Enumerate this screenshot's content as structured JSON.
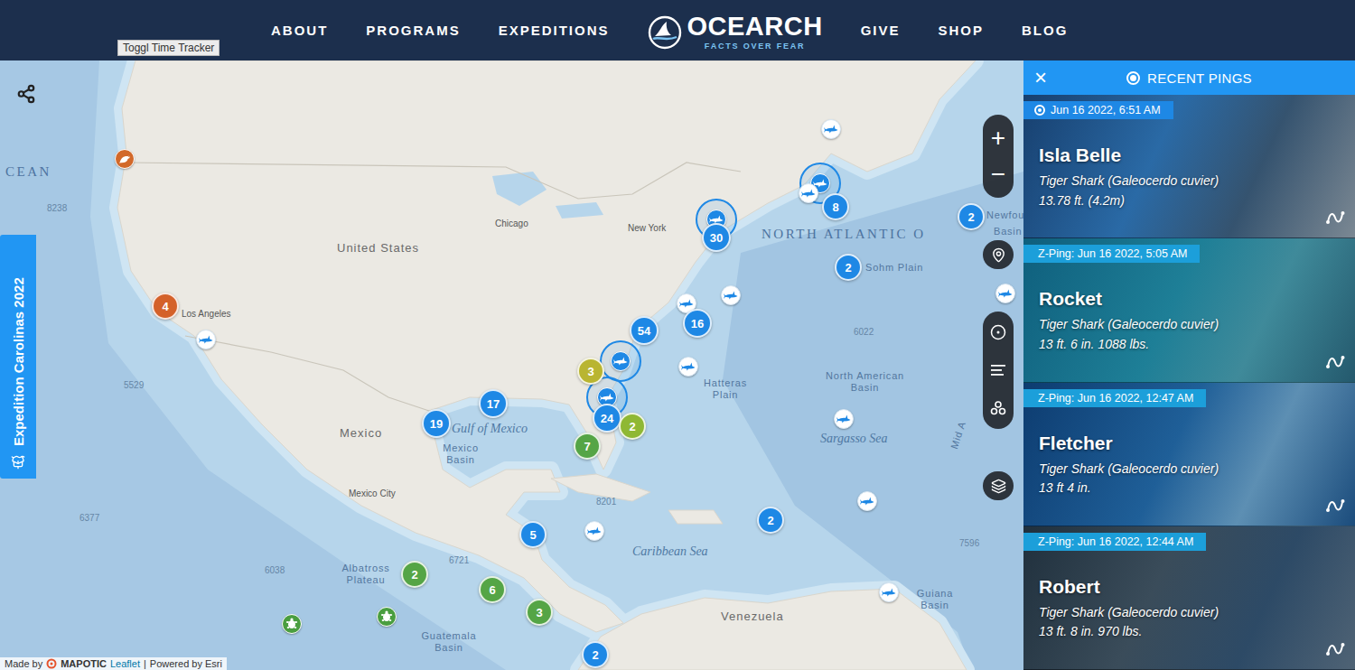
{
  "header": {
    "nav_left": [
      "ABOUT",
      "PROGRAMS",
      "EXPEDITIONS"
    ],
    "logo": {
      "name": "OCEARCH",
      "tagline": "FACTS OVER FEAR"
    },
    "nav_right": [
      "GIVE",
      "SHOP",
      "BLOG"
    ]
  },
  "tooltip": "Toggl Time Tracker",
  "map": {
    "expedition_tab": "Expedition Carolinas 2022",
    "controls": {
      "zoom_in": "+",
      "zoom_out": "−"
    },
    "attribution": {
      "made_by": "Made by",
      "brand": "MAPOTIC",
      "links": [
        "Leaflet",
        "Powered by Esri"
      ],
      "separator": "|"
    },
    "labels": [
      {
        "text": "CEAN",
        "kind": "ocean"
      },
      {
        "text": "8238",
        "kind": "depth"
      },
      {
        "text": "United States",
        "kind": "country"
      },
      {
        "text": "Chicago",
        "kind": "city"
      },
      {
        "text": "New York",
        "kind": "city"
      },
      {
        "text": "Los Angeles",
        "kind": "city"
      },
      {
        "text": "5529",
        "kind": "depth"
      },
      {
        "text": "Mexico",
        "kind": "country"
      },
      {
        "text": "Mexico City",
        "kind": "city"
      },
      {
        "text": "6377",
        "kind": "depth"
      },
      {
        "text": "Gulf of Mexico",
        "kind": "sea"
      },
      {
        "text": "Mexico Basin",
        "kind": "feature"
      },
      {
        "text": "8201",
        "kind": "depth"
      },
      {
        "text": "Caribbean Sea",
        "kind": "sea"
      },
      {
        "text": "7596",
        "kind": "depth"
      },
      {
        "text": "Guiana Basin",
        "kind": "feature"
      },
      {
        "text": "Venezuela",
        "kind": "country"
      },
      {
        "text": "Albatross Plateau",
        "kind": "feature"
      },
      {
        "text": "6721",
        "kind": "depth"
      },
      {
        "text": "6038",
        "kind": "depth"
      },
      {
        "text": "Guatemala Basin",
        "kind": "feature"
      },
      {
        "text": "NORTH ATLANTIC O",
        "kind": "ocean"
      },
      {
        "text": "Sohm Plain",
        "kind": "feature"
      },
      {
        "text": "6022",
        "kind": "depth"
      },
      {
        "text": "North American Basin",
        "kind": "feature"
      },
      {
        "text": "Hatteras Plain",
        "kind": "feature"
      },
      {
        "text": "Sargasso Sea",
        "kind": "sea"
      },
      {
        "text": "Mid A",
        "kind": "rotated"
      },
      {
        "text": "Newfou",
        "kind": "feature"
      },
      {
        "text": "Basin",
        "kind": "feature"
      }
    ],
    "markers": [
      {
        "kind": "seal",
        "color": "#d2692a",
        "recent": false
      },
      {
        "kind": "cluster",
        "count": "4",
        "color": "#d4612a",
        "recent": false
      },
      {
        "kind": "shark",
        "color": "#1e88e5",
        "recent": false
      },
      {
        "kind": "shark",
        "color": "#1e88e5",
        "recent": false
      },
      {
        "kind": "shark",
        "color": "#1e88e5",
        "recent": true
      },
      {
        "kind": "shark",
        "color": "#1e88e5",
        "recent": false
      },
      {
        "kind": "cluster",
        "count": "8",
        "color": "#1e88e5",
        "recent": false
      },
      {
        "kind": "shark",
        "color": "#1e88e5",
        "recent": true
      },
      {
        "kind": "cluster",
        "count": "30",
        "color": "#1e88e5",
        "recent": false
      },
      {
        "kind": "cluster",
        "count": "2",
        "color": "#1e88e5",
        "recent": false
      },
      {
        "kind": "cluster",
        "count": "2",
        "color": "#1e88e5",
        "recent": false
      },
      {
        "kind": "shark",
        "color": "#1e88e5",
        "recent": false
      },
      {
        "kind": "shark",
        "color": "#1e88e5",
        "recent": false
      },
      {
        "kind": "shark",
        "color": "#1e88e5",
        "recent": false
      },
      {
        "kind": "cluster",
        "count": "54",
        "color": "#1e88e5",
        "recent": false
      },
      {
        "kind": "cluster",
        "count": "16",
        "color": "#1e88e5",
        "recent": false
      },
      {
        "kind": "shark",
        "color": "#1e88e5",
        "recent": true
      },
      {
        "kind": "shark",
        "color": "#1e88e5",
        "recent": false
      },
      {
        "kind": "cluster",
        "count": "3",
        "color": "#b9b531",
        "recent": false
      },
      {
        "kind": "cluster",
        "count": "17",
        "color": "#1e88e5",
        "recent": false
      },
      {
        "kind": "cluster",
        "count": "19",
        "color": "#1e88e5",
        "recent": false
      },
      {
        "kind": "shark",
        "color": "#1e88e5",
        "recent": true
      },
      {
        "kind": "cluster",
        "count": "24",
        "color": "#1e88e5",
        "recent": false
      },
      {
        "kind": "cluster",
        "count": "7",
        "color": "#55a546",
        "recent": false
      },
      {
        "kind": "cluster",
        "count": "2",
        "color": "#8fb834",
        "recent": false
      },
      {
        "kind": "shark",
        "color": "#1e88e5",
        "recent": false
      },
      {
        "kind": "shark",
        "color": "#1e88e5",
        "recent": false
      },
      {
        "kind": "shark",
        "color": "#1e88e5",
        "recent": false
      },
      {
        "kind": "shark",
        "color": "#1e88e5",
        "recent": false
      },
      {
        "kind": "cluster",
        "count": "2",
        "color": "#1e88e5",
        "recent": false
      },
      {
        "kind": "cluster",
        "count": "5",
        "color": "#1e88e5",
        "recent": false
      },
      {
        "kind": "cluster",
        "count": "2",
        "color": "#55a546",
        "recent": false
      },
      {
        "kind": "cluster",
        "count": "6",
        "color": "#55a546",
        "recent": false
      },
      {
        "kind": "cluster",
        "count": "3",
        "color": "#55a546",
        "recent": false
      },
      {
        "kind": "cluster",
        "count": "2",
        "color": "#1e88e5",
        "recent": false
      },
      {
        "kind": "turtle",
        "color": "#4a9e40",
        "recent": false
      },
      {
        "kind": "turtle",
        "color": "#4a9e40",
        "recent": false
      }
    ]
  },
  "sidebar": {
    "close": "×",
    "title": "RECENT PINGS",
    "pings": [
      {
        "time": "Jun 16 2022, 6:51 AM",
        "live": true,
        "name": "Isla Belle",
        "species": "Tiger Shark (Galeocerdo cuvier)",
        "size": "13.78 ft. (4.2m)"
      },
      {
        "time": "Z-Ping: Jun 16 2022, 5:05 AM",
        "live": false,
        "name": "Rocket",
        "species": "Tiger Shark (Galeocerdo cuvier)",
        "size": "13 ft. 6 in. 1088 lbs."
      },
      {
        "time": "Z-Ping: Jun 16 2022, 12:47 AM",
        "live": false,
        "name": "Fletcher",
        "species": "Tiger Shark (Galeocerdo cuvier)",
        "size": "13 ft 4 in."
      },
      {
        "time": "Z-Ping: Jun 16 2022, 12:44 AM",
        "live": false,
        "name": "Robert",
        "species": "Tiger Shark (Galeocerdo cuvier)",
        "size": "13 ft. 8 in. 970 lbs."
      }
    ]
  }
}
